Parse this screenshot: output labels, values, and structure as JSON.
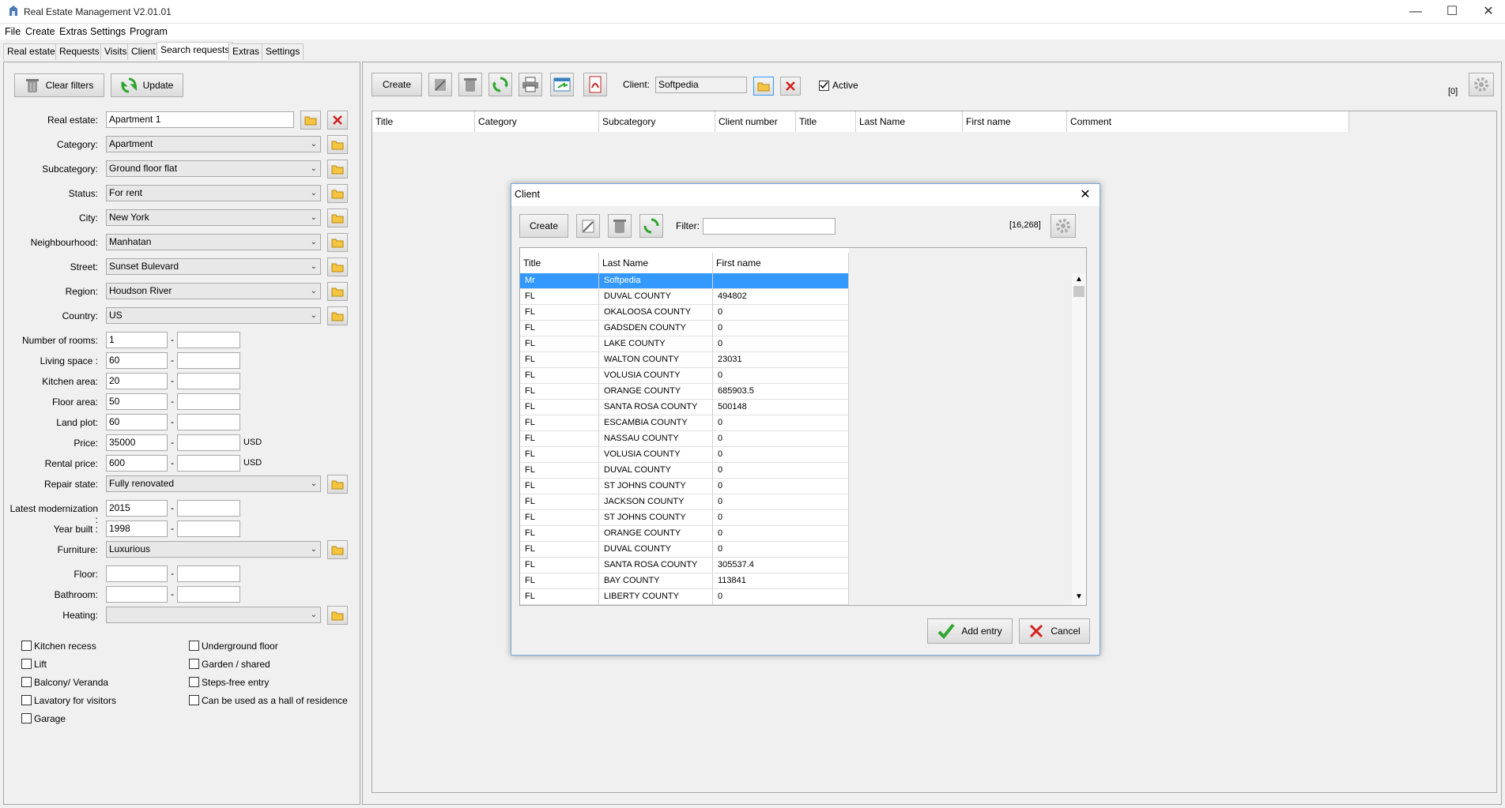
{
  "window": {
    "title": "Real Estate Management V2.01.01",
    "controls": {
      "minimize": "—",
      "maximize": "☐",
      "close": "✕"
    }
  },
  "menu": [
    "File",
    "Create",
    "Extras",
    "Settings",
    "Program"
  ],
  "tabs": [
    "Real estate",
    "Requests",
    "Visits",
    "Client",
    "Search requests",
    "Extras",
    "Settings"
  ],
  "active_tab": "Search requests",
  "left_panel": {
    "clear_filters": "Clear filters",
    "update": "Update",
    "combos": [
      {
        "label": "Real estate:",
        "value": "Apartment 1"
      },
      {
        "label": "Category:",
        "value": "Apartment"
      },
      {
        "label": "Subcategory:",
        "value": "Ground floor flat"
      },
      {
        "label": "Status:",
        "value": "For rent"
      },
      {
        "label": "City:",
        "value": "New York"
      },
      {
        "label": "Neighbourhood:",
        "value": "Manhatan"
      },
      {
        "label": "Street:",
        "value": "Sunset Bulevard"
      },
      {
        "label": "Region:",
        "value": "Houdson River"
      },
      {
        "label": "Country:",
        "value": "US"
      }
    ],
    "ranges": [
      {
        "label": "Number of rooms:",
        "from": "1",
        "to": "",
        "unit": ""
      },
      {
        "label": "Living space :",
        "from": "60",
        "to": "",
        "unit": ""
      },
      {
        "label": "Kitchen area:",
        "from": "20",
        "to": "",
        "unit": ""
      },
      {
        "label": "Floor area:",
        "from": "50",
        "to": "",
        "unit": ""
      },
      {
        "label": "Land plot:",
        "from": "60",
        "to": "",
        "unit": ""
      },
      {
        "label": "Price:",
        "from": "35000",
        "to": "",
        "unit": "USD"
      },
      {
        "label": "Rental price:",
        "from": "600",
        "to": "",
        "unit": "USD"
      }
    ],
    "repair_state": {
      "label": "Repair state:",
      "value": "Fully renovated"
    },
    "latest_modernization": {
      "label": "Latest modernization :",
      "from": "2015",
      "to": ""
    },
    "year_built": {
      "label": "Year built :",
      "from": "1998",
      "to": ""
    },
    "furniture": {
      "label": "Furniture:",
      "value": "Luxurious"
    },
    "floor": {
      "label": "Floor:",
      "from": "",
      "to": ""
    },
    "bathroom": {
      "label": "Bathroom:",
      "from": "",
      "to": ""
    },
    "heating": {
      "label": "Heating:",
      "value": ""
    },
    "range_separator": "-",
    "checkboxes_left": [
      "Kitchen recess",
      "Lift",
      "Balcony/ Veranda",
      "Lavatory for visitors",
      "Garage"
    ],
    "checkboxes_right": [
      "Underground floor",
      "Garden / shared",
      "Steps-free entry",
      "Can be used as a hall of residence"
    ]
  },
  "main_panel": {
    "create": "Create",
    "client_label": "Client:",
    "client_value": "Softpedia",
    "active_label": "Active",
    "active_checked": true,
    "count": "[0]",
    "columns": [
      "Title",
      "Category",
      "Subcategory",
      "Client number",
      "Title",
      "Last Name",
      "First name",
      "Comment"
    ]
  },
  "dialog": {
    "title": "Client",
    "create": "Create",
    "filter_label": "Filter:",
    "filter_value": "",
    "count": "[16,268]",
    "columns": [
      "Title",
      "Last Name",
      "First name"
    ],
    "rows": [
      [
        "Mr",
        "Softpedia",
        ""
      ],
      [
        "FL",
        "DUVAL COUNTY",
        "494802"
      ],
      [
        "FL",
        "OKALOOSA COUNTY",
        "0"
      ],
      [
        "FL",
        "GADSDEN COUNTY",
        "0"
      ],
      [
        "FL",
        "LAKE COUNTY",
        "0"
      ],
      [
        "FL",
        "WALTON COUNTY",
        "23031"
      ],
      [
        "FL",
        "VOLUSIA COUNTY",
        "0"
      ],
      [
        "FL",
        "ORANGE COUNTY",
        "685903.5"
      ],
      [
        "FL",
        "SANTA ROSA COUNTY",
        "500148"
      ],
      [
        "FL",
        "ESCAMBIA COUNTY",
        "0"
      ],
      [
        "FL",
        "NASSAU COUNTY",
        "0"
      ],
      [
        "FL",
        "VOLUSIA COUNTY",
        "0"
      ],
      [
        "FL",
        "DUVAL COUNTY",
        "0"
      ],
      [
        "FL",
        "ST  JOHNS COUNTY",
        "0"
      ],
      [
        "FL",
        "JACKSON COUNTY",
        "0"
      ],
      [
        "FL",
        "ST  JOHNS COUNTY",
        "0"
      ],
      [
        "FL",
        "ORANGE COUNTY",
        "0"
      ],
      [
        "FL",
        "DUVAL COUNTY",
        "0"
      ],
      [
        "FL",
        "SANTA ROSA COUNTY",
        "305537.4"
      ],
      [
        "FL",
        "BAY COUNTY",
        "113841"
      ],
      [
        "FL",
        "LIBERTY COUNTY",
        "0"
      ]
    ],
    "add_entry": "Add entry",
    "cancel": "Cancel"
  },
  "colors": {
    "selection": "#3399ff",
    "accent_green": "#2ea52e",
    "accent_red": "#d42020",
    "folder_yellow": "#f5c542"
  }
}
